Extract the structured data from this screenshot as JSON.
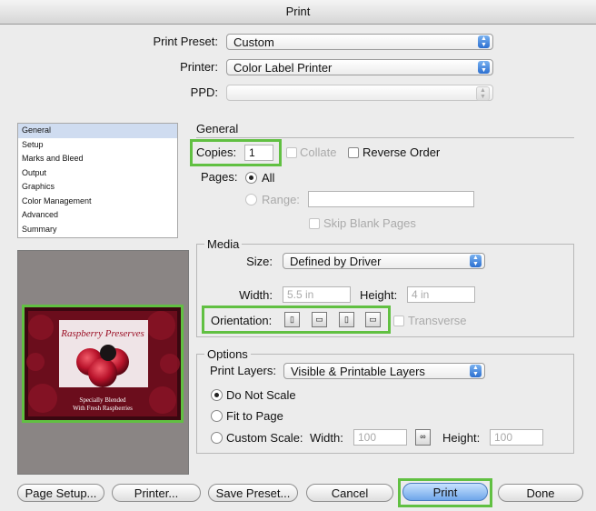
{
  "window": {
    "title": "Print"
  },
  "preset": {
    "label": "Print Preset:",
    "value": "Custom"
  },
  "printer": {
    "label": "Printer:",
    "value": "Color Label Printer"
  },
  "ppd": {
    "label": "PPD:",
    "value": ""
  },
  "sidebar": {
    "items": [
      {
        "label": "General",
        "selected": true
      },
      {
        "label": "Setup"
      },
      {
        "label": "Marks and Bleed"
      },
      {
        "label": "Output"
      },
      {
        "label": "Graphics"
      },
      {
        "label": "Color Management"
      },
      {
        "label": "Advanced"
      },
      {
        "label": "Summary"
      }
    ]
  },
  "preview": {
    "headline": "Raspberry Preserves",
    "subline1": "Specially Blended",
    "subline2": "With Fresh Raspberries"
  },
  "general": {
    "title": "General",
    "copies_label": "Copies:",
    "copies_value": "1",
    "collate_label": "Collate",
    "reverse_label": "Reverse Order",
    "pages_label": "Pages:",
    "all_label": "All",
    "range_label": "Range:",
    "range_value": "",
    "skip_blank_label": "Skip Blank Pages"
  },
  "media": {
    "title": "Media",
    "size_label": "Size:",
    "size_value": "Defined by Driver",
    "width_label": "Width:",
    "width_value": "5.5 in",
    "height_label": "Height:",
    "height_value": "4 in",
    "orientation_label": "Orientation:",
    "transverse_label": "Transverse"
  },
  "options": {
    "title": "Options",
    "print_layers_label": "Print Layers:",
    "print_layers_value": "Visible & Printable Layers",
    "do_not_scale_label": "Do Not Scale",
    "fit_to_page_label": "Fit to Page",
    "custom_scale_label": "Custom Scale:",
    "width_label": "Width:",
    "width_value": "100",
    "height_label": "Height:",
    "height_value": "100"
  },
  "buttons": {
    "page_setup": "Page Setup...",
    "printer": "Printer...",
    "save_preset": "Save Preset...",
    "cancel": "Cancel",
    "print": "Print",
    "done": "Done"
  },
  "colors": {
    "highlight": "#61c042",
    "default_button": "#6fa6ea"
  }
}
